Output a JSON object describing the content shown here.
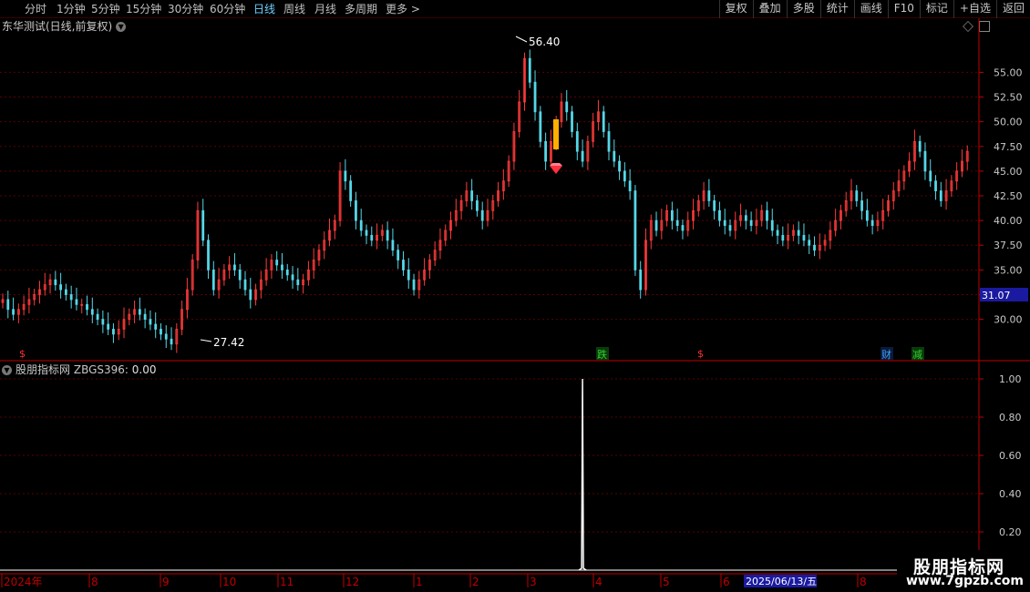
{
  "toolbar": {
    "periods": [
      "分时",
      "1分钟",
      "5分钟",
      "15分钟",
      "30分钟",
      "60分钟",
      "日线",
      "周线",
      "月线",
      "多周期",
      "更多 >"
    ],
    "active_period": "日线",
    "tools": [
      "复权",
      "叠加",
      "多股",
      "统计",
      "画线",
      "F10",
      "标记",
      "+自选",
      "返回"
    ]
  },
  "stock": {
    "title": "东华测试(日线,前复权)",
    "current_price_label": "31.07",
    "high_label": "56.40",
    "low_label": "27.42"
  },
  "indicator": {
    "name": "股朋指标网",
    "formula": "ZBGS396:",
    "value": "0.00"
  },
  "markers": [
    {
      "text": "$",
      "color": "#ff3030"
    },
    {
      "text": "跌",
      "color": "#30d030"
    },
    {
      "text": "$",
      "color": "#ff3030"
    },
    {
      "text": "财",
      "color": "#40a0ff"
    },
    {
      "text": "减",
      "color": "#30d030"
    }
  ],
  "date_axis": {
    "labels": [
      "2024年",
      "8",
      "9",
      "10",
      "11",
      "12",
      "1",
      "2",
      "3",
      "4",
      "5",
      "6",
      "8"
    ],
    "crosshair_date": "2025/06/13/五"
  },
  "watermark": {
    "line1": "股朋指标网",
    "line2": "www.7gpzb.com"
  },
  "colors": {
    "up": "#ff3b3b",
    "down": "#54d8e8",
    "grid": "#5a0000",
    "axis": "#c00000",
    "price_tag": "#1a1aa0",
    "date_tag": "#1a1aa0",
    "signal_bar": "#ffb000"
  },
  "chart_data": [
    {
      "type": "candlestick",
      "title": "东华测试(日线,前复权)",
      "y_ticks": [
        30.0,
        32.5,
        35.0,
        37.5,
        40.0,
        42.5,
        45.0,
        47.5,
        50.0,
        52.5,
        55.0
      ],
      "ylim": [
        26.0,
        59.0
      ],
      "close_series": [
        32,
        31,
        30.5,
        31,
        31.5,
        32,
        32.5,
        33,
        33.5,
        34,
        33.5,
        33,
        32.5,
        32,
        31.5,
        31.5,
        31,
        30.5,
        30,
        29.5,
        29,
        28.5,
        29,
        30,
        30.5,
        31,
        30.5,
        30,
        29.5,
        29,
        28.5,
        28,
        27.5,
        29,
        31,
        33,
        36,
        41,
        38,
        35,
        33,
        34,
        35,
        35.5,
        35,
        34,
        33,
        32,
        33,
        34,
        35,
        36,
        35.5,
        35,
        34.5,
        34,
        33.5,
        34,
        35,
        36,
        37,
        38,
        39,
        40,
        45,
        44,
        42,
        40,
        39,
        38.5,
        38,
        38.5,
        39,
        38,
        37,
        36,
        35,
        34,
        33,
        34,
        35,
        36,
        37,
        38,
        39,
        40,
        41,
        42,
        43,
        42,
        41,
        40,
        41,
        42,
        43,
        44,
        46,
        49,
        52,
        56.4,
        54,
        51,
        48,
        46,
        48,
        50,
        52,
        51,
        49,
        47,
        46,
        48,
        50,
        51,
        49,
        47,
        46,
        45,
        44,
        43,
        35,
        33,
        38,
        40,
        39,
        40,
        41,
        40,
        39.5,
        39,
        40,
        41,
        42,
        43,
        42,
        41,
        40,
        39.5,
        39,
        40,
        40.5,
        40,
        39.5,
        40,
        41,
        40,
        39,
        38.5,
        38,
        38.5,
        39,
        38.5,
        38,
        37.5,
        37,
        37.5,
        38,
        39,
        40,
        41,
        42,
        43,
        42,
        41,
        40,
        39.5,
        40,
        41,
        42,
        43,
        44,
        45,
        46,
        48,
        47,
        45,
        44,
        43,
        42,
        43,
        44,
        45,
        46,
        47
      ],
      "high": 56.4,
      "low": 27.42,
      "last_price": 31.07,
      "x_labels": [
        "2024年",
        "8",
        "9",
        "10",
        "11",
        "12",
        "1",
        "2",
        "3",
        "4",
        "5",
        "6",
        "8"
      ]
    },
    {
      "type": "line",
      "title": "股朋指标网 ZBGS396",
      "y_ticks": [
        0.2,
        0.4,
        0.6,
        0.8,
        1.0
      ],
      "ylim": [
        0.0,
        1.0
      ],
      "signal_index": 110,
      "values_note_zero_elsewhere": 0
    }
  ]
}
